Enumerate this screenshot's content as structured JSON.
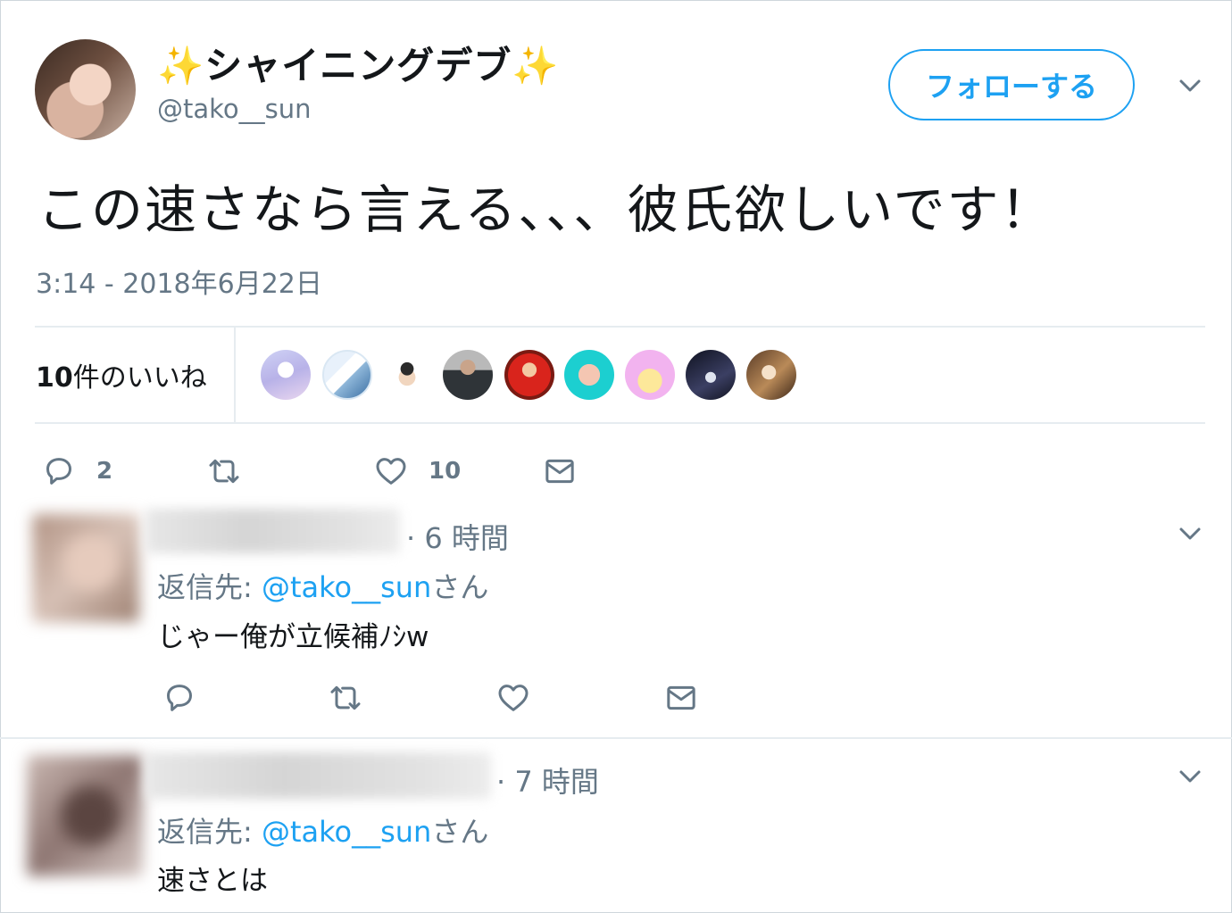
{
  "tweet": {
    "display_name": "シャイニングデブ",
    "sparkle_left": "✨",
    "sparkle_right": "✨",
    "screen_name": "@tako__sun",
    "follow_label": "フォローする",
    "text": "この速さなら言える、、、彼氏欲しいです！",
    "timestamp": "3:14 - 2018年6月22日",
    "likes_count": "10",
    "likes_unit": "件のいいね",
    "actions": {
      "reply_count": "2",
      "like_count": "10"
    }
  },
  "colors": {
    "accent": "#1da1f2",
    "secondary_text": "#657786",
    "divider": "#e6ecf0"
  },
  "icons": [
    "reply-icon",
    "retweet-icon",
    "heart-icon",
    "message-icon",
    "chevron-down-icon"
  ],
  "replies": [
    {
      "time": "· 6 時間",
      "replying_prefix": "返信先:",
      "replying_handle": "@tako__sun",
      "replying_suffix": "さん",
      "text": "じゃー俺が立候補ﾉｼw"
    },
    {
      "time": "· 7 時間",
      "replying_prefix": "返信先:",
      "replying_handle": "@tako__sun",
      "replying_suffix": "さん",
      "text": "速さとは"
    }
  ]
}
